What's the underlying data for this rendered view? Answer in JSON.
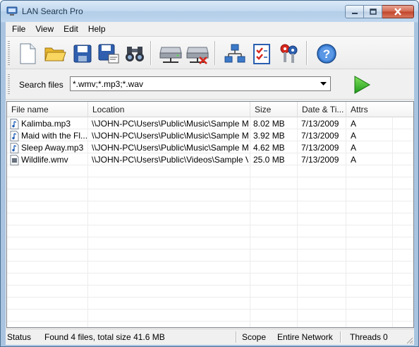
{
  "window": {
    "title": "LAN Search Pro"
  },
  "menu": [
    {
      "label": "File"
    },
    {
      "label": "View"
    },
    {
      "label": "Edit"
    },
    {
      "label": "Help"
    }
  ],
  "toolbar": {
    "buttons": [
      {
        "icon": "new-document-icon"
      },
      {
        "icon": "open-folder-icon"
      },
      {
        "icon": "save-icon"
      },
      {
        "icon": "save-as-icon"
      },
      {
        "icon": "binoculars-icon"
      },
      {
        "icon": "network-drive-icon"
      },
      {
        "icon": "disconnect-drive-icon"
      },
      {
        "icon": "network-icon"
      },
      {
        "icon": "checklist-icon"
      },
      {
        "icon": "keys-icon"
      },
      {
        "icon": "help-icon"
      }
    ]
  },
  "search": {
    "label": "Search files",
    "value": "*.wmv;*.mp3;*.wav"
  },
  "columns": [
    "File name",
    "Location",
    "Size",
    "Date & Ti...",
    "Attrs"
  ],
  "rows": [
    {
      "name": "Kalimba.mp3",
      "location": "\\\\JOHN-PC\\Users\\Public\\Music\\Sample Music",
      "size": "8.02 MB",
      "date": "7/13/2009",
      "attrs": "A",
      "type": "audio"
    },
    {
      "name": "Maid with the Fl...",
      "location": "\\\\JOHN-PC\\Users\\Public\\Music\\Sample Music",
      "size": "3.92 MB",
      "date": "7/13/2009",
      "attrs": "A",
      "type": "audio"
    },
    {
      "name": "Sleep Away.mp3",
      "location": "\\\\JOHN-PC\\Users\\Public\\Music\\Sample Music",
      "size": "4.62 MB",
      "date": "7/13/2009",
      "attrs": "A",
      "type": "audio"
    },
    {
      "name": "Wildlife.wmv",
      "location": "\\\\JOHN-PC\\Users\\Public\\Videos\\Sample Vi...",
      "size": "25.0 MB",
      "date": "7/13/2009",
      "attrs": "A",
      "type": "video"
    }
  ],
  "status": {
    "status_label": "Status",
    "status_text": "Found 4 files, total size 41.6 MB",
    "scope_label": "Scope",
    "scope_value": "Entire Network",
    "threads_label": "Threads",
    "threads_value": "0"
  }
}
